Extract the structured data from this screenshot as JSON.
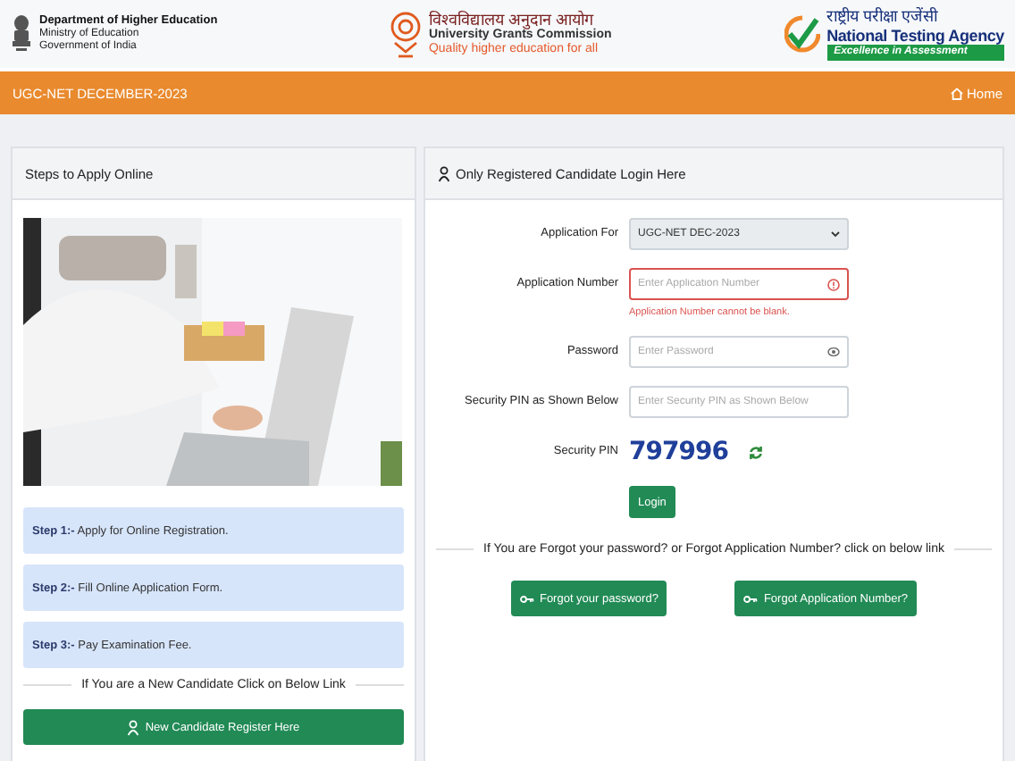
{
  "header": {
    "ministry": {
      "lines": [
        "Department of Higher Education",
        "Ministry of Education",
        "Government of India"
      ]
    },
    "ugc": {
      "hindi": "विश्वविद्यालय अनुदान आयोग",
      "name": "University Grants Commission",
      "tagline": "Quality higher education for all"
    },
    "nta": {
      "hindi": "राष्ट्रीय परीक्षा एजेंसी",
      "name": "National Testing Agency",
      "tagline": "Excellence in Assessment"
    }
  },
  "nav": {
    "title": "UGC-NET DECEMBER-2023",
    "home": "Home"
  },
  "steps_panel": {
    "title": "Steps to Apply Online",
    "image": {
      "kind": "picture"
    },
    "steps": [
      "**Step 1:-** Apply for Online Registration.",
      "**Step 2:-** Fill Online Application Form.",
      "**Step 3:-** Pay Examination Fee."
    ],
    "divider": "If You are a New Candidate Click on Below Link",
    "register_button": "New Candidate Register Here"
  },
  "login_panel": {
    "title": "Only Registered Candidate Login Here",
    "fields": [
      {
        "kind": "select",
        "label": "Application For",
        "value": "UGC-NET DEC-2023",
        "invalid": false
      },
      {
        "kind": "input",
        "label": "Application Number",
        "placeholder": "Enter Application Number",
        "invalid": true,
        "error": "Application Number cannot be blank."
      },
      {
        "kind": "password",
        "label": "Password",
        "placeholder": "Enter Password",
        "invalid": false
      },
      {
        "kind": "input",
        "label": "Security PIN as Shown Below",
        "placeholder": "Enter Security PIN as Shown Below",
        "invalid": false
      }
    ],
    "captcha": {
      "label": "Security PIN",
      "value": "797996"
    },
    "login_button": "Login",
    "divider": "If You are Forgot your password? or Forgot Application Number? click on below link",
    "links": [
      "Forgot your password?",
      "Forgot Application Number?"
    ]
  }
}
